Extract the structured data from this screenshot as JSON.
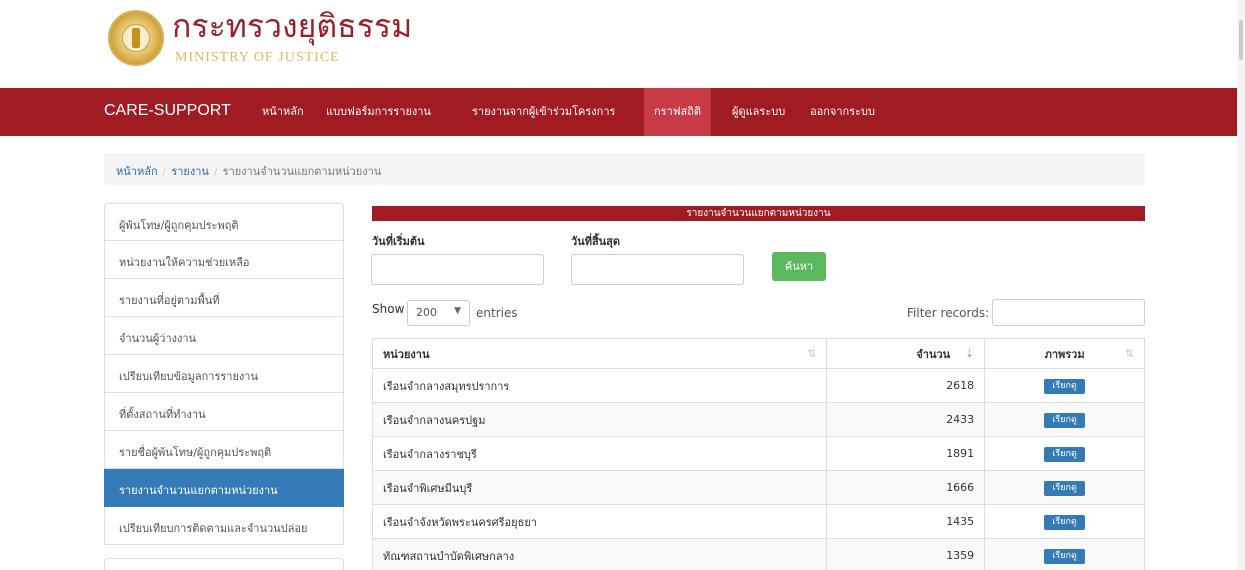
{
  "header": {
    "logo_thai": "กระทรวงยุติธรรม",
    "logo_en": "MINISTRY OF JUSTICE"
  },
  "navbar": {
    "brand": "CARE-SUPPORT",
    "items": [
      {
        "label": "หน้าหลัก"
      },
      {
        "label": "แบบฟอร์มการรายงาน"
      },
      {
        "label": "รายงานจากผู้เข้าร่วมโครงการ"
      },
      {
        "label": "กราฟสถิติ"
      },
      {
        "label": "ผู้ดูแลระบบ"
      },
      {
        "label": "ออกจากระบบ"
      }
    ]
  },
  "breadcrumb": {
    "home": "หน้าหลัก",
    "report": "รายงาน",
    "current": "รายงานจำนวนแยกตามหน่วยงาน"
  },
  "sidebar": {
    "items": [
      {
        "label": "ผู้พ้นโทษ/ผู้ถูกคุมประพฤติ"
      },
      {
        "label": "หน่วยงานให้ความช่วยเหลือ"
      },
      {
        "label": "รายงานที่อยู่ตามพื้นที่"
      },
      {
        "label": "จำนวนผู้ว่างงาน"
      },
      {
        "label": "เปรียบเทียบข้อมูลการรายงาน"
      },
      {
        "label": "ที่ตั้งสถานที่ทำงาน"
      },
      {
        "label": "รายชื่อผู้พ้นโทษ/ผู้ถูกคุมประพฤติ"
      },
      {
        "label": "รายงานจำนวนแยกตามหน่วยงาน"
      },
      {
        "label": "เปรียบเทียบการติดตามและจำนวนปล่อย"
      }
    ]
  },
  "main": {
    "panel_title": "รายงานจำนวนแยกตามหน่วยงาน",
    "start_date_label": "วันที่เริ่มต้น",
    "end_date_label": "วันที่สิ้นสุด",
    "search_label": "ค้นหา",
    "show_label": "Show",
    "page_size": "200",
    "entries_label": "entries",
    "filter_label": "Filter records:",
    "columns": {
      "agency": "หน่วยงาน",
      "count": "จำนวน",
      "overview": "ภาพรวม"
    },
    "rows": [
      {
        "agency": "เรือนจำกลางสมุทรปราการ",
        "count": "2618",
        "action": "เรียกดู"
      },
      {
        "agency": "เรือนจำกลางนครปฐม",
        "count": "2433",
        "action": "เรียกดู"
      },
      {
        "agency": "เรือนจำกลางราชบุรี",
        "count": "1891",
        "action": "เรียกดู"
      },
      {
        "agency": "เรือนจำพิเศษมีนบุรี",
        "count": "1666",
        "action": "เรียกดู"
      },
      {
        "agency": "เรือนจำจังหวัดพระนครศรีอยุธยา",
        "count": "1435",
        "action": "เรียกดู"
      },
      {
        "agency": "ทัณฑสถานบำบัดพิเศษกลาง",
        "count": "1359",
        "action": "เรียกดู"
      }
    ]
  },
  "colors": {
    "brand_red": "#a01c22",
    "active_blue": "#337ab7",
    "search_green": "#5cb85c"
  }
}
